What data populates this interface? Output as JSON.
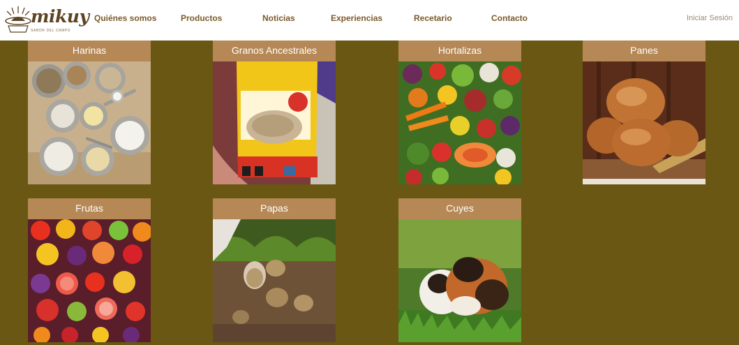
{
  "brand": {
    "name": "mikuy",
    "tagline": "SABOR DEL CAMPO"
  },
  "nav": {
    "items": [
      {
        "label": "Quiénes somos"
      },
      {
        "label": "Productos"
      },
      {
        "label": "Noticias"
      },
      {
        "label": "Experiencias"
      },
      {
        "label": "Recetario"
      },
      {
        "label": "Contacto"
      }
    ],
    "login_label": "Iniciar Sesión"
  },
  "categories": [
    {
      "title": "Harinas"
    },
    {
      "title": "Granos Ancestrales"
    },
    {
      "title": "Hortalizas"
    },
    {
      "title": "Panes"
    },
    {
      "title": "Frutas"
    },
    {
      "title": "Papas"
    },
    {
      "title": "Cuyes"
    }
  ],
  "colors": {
    "background": "#6a5714",
    "card_header": "#b58855",
    "nav_text": "#7a5a2a",
    "login_text": "#9a8a75"
  }
}
